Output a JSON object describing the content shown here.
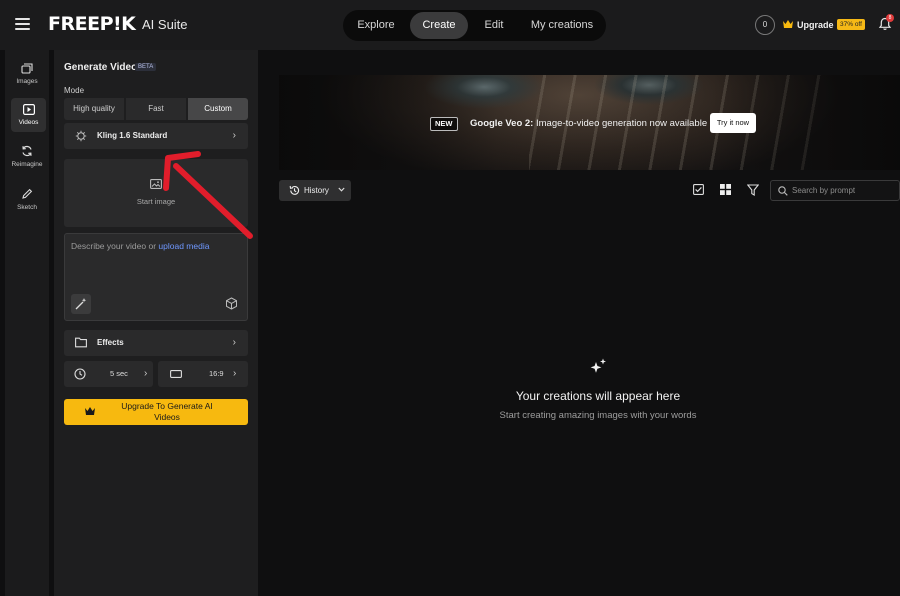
{
  "header": {
    "logo": "FREEP!K",
    "suite": "AI Suite",
    "nav": [
      "Explore",
      "Create",
      "Edit",
      "My creations"
    ],
    "active_nav": "Create",
    "credits": "0",
    "upgrade_label": "Upgrade",
    "discount_badge": "37% off",
    "notification_count": "8"
  },
  "rail": [
    {
      "label": "Images",
      "icon": "images-icon"
    },
    {
      "label": "Videos",
      "icon": "video-icon",
      "active": true
    },
    {
      "label": "Reimagine",
      "icon": "reimagine-icon"
    },
    {
      "label": "Sketch",
      "icon": "pencil-icon"
    }
  ],
  "panel": {
    "title": "Generate Video",
    "badge": "BETA",
    "mode_label": "Mode",
    "modes": [
      "High quality",
      "Fast",
      "Custom"
    ],
    "selected_mode": "Custom",
    "model": "Kling 1.6 Standard",
    "start_image_label": "Start image",
    "prompt_placeholder": "Describe your video or",
    "prompt_link": "upload media",
    "effects_label": "Effects",
    "duration": "5 sec",
    "aspect_ratio": "16:9",
    "upgrade_button": "Upgrade To Generate AI Videos"
  },
  "banner": {
    "tag": "NEW",
    "headline_bold": "Google Veo 2:",
    "headline_rest": " Image-to-video generation now available",
    "cta": "Try it now"
  },
  "toolbar": {
    "history_label": "History",
    "search_placeholder": "Search by prompt"
  },
  "empty_state": {
    "title": "Your creations will appear here",
    "subtitle": "Start creating amazing images with your words"
  },
  "colors": {
    "accent_yellow": "#f7b90f",
    "link_blue": "#6f98ff",
    "annotation_arrow": "#e11d2b"
  }
}
